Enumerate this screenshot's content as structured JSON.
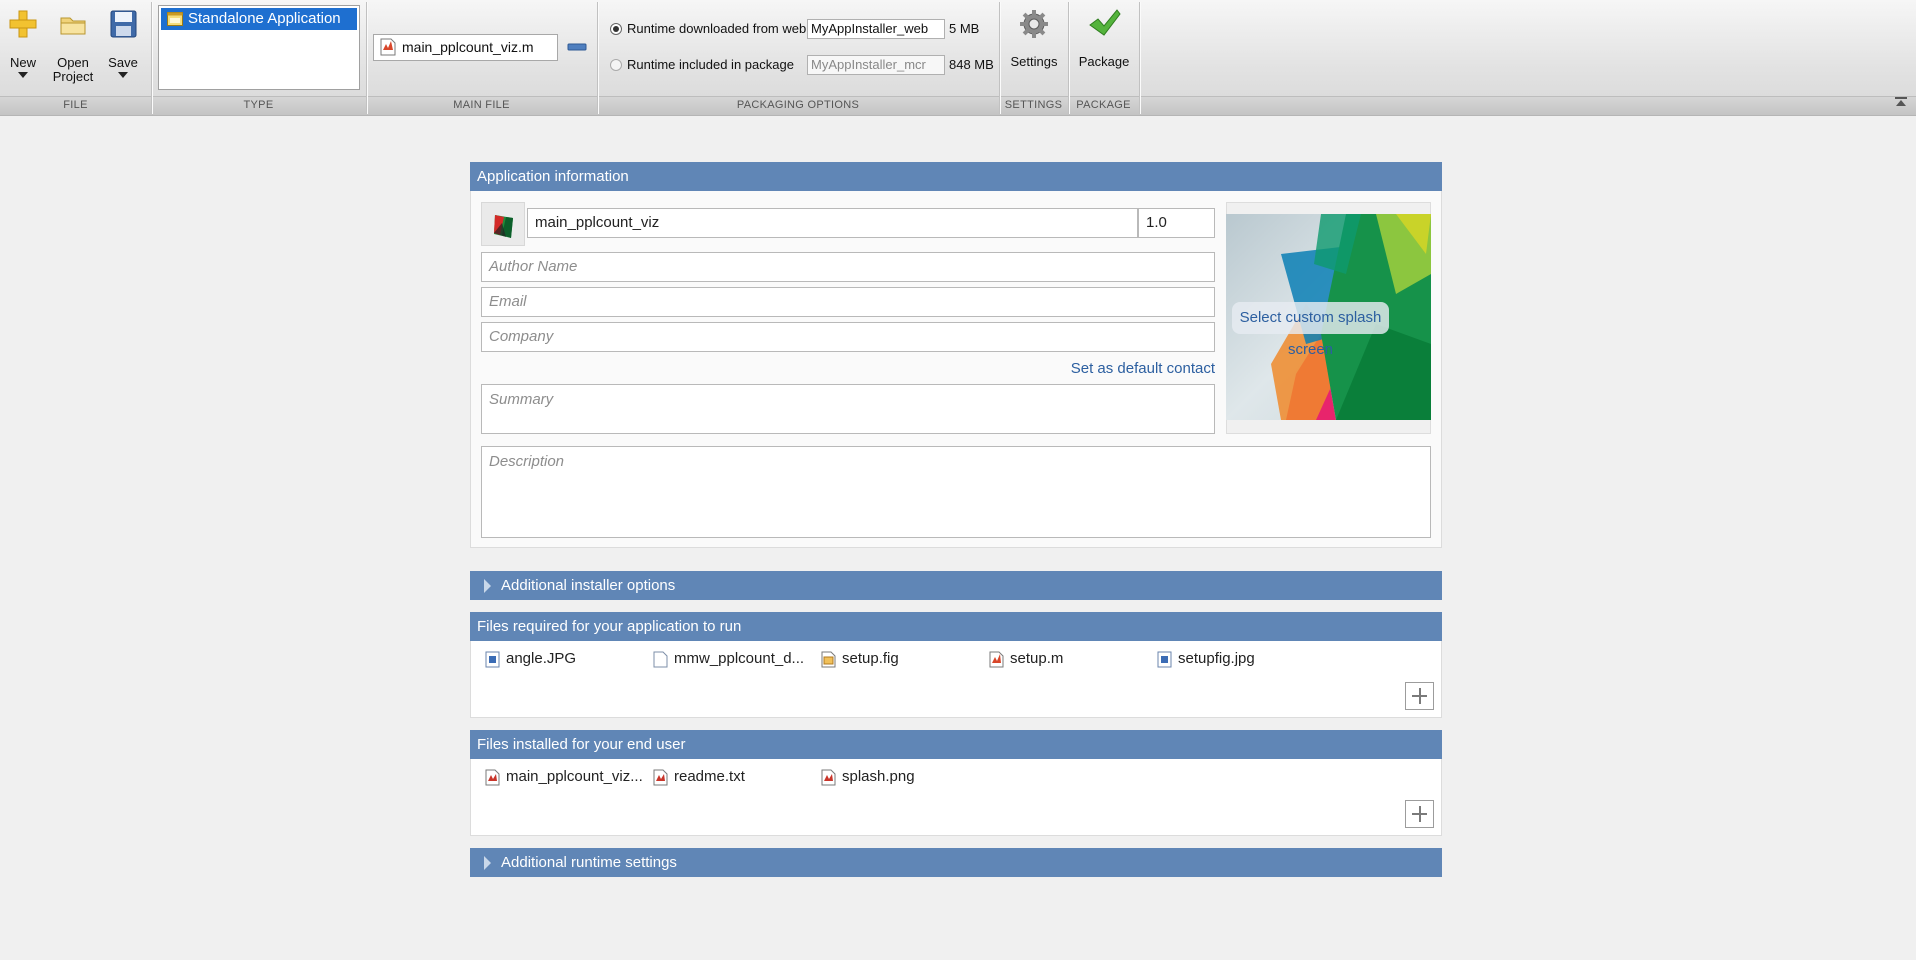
{
  "toolbar": {
    "new_label": "New",
    "open_label_1": "Open",
    "open_label_2": "Project",
    "save_label": "Save",
    "settings_label": "Settings",
    "package_label": "Package"
  },
  "groups": {
    "file": "FILE",
    "type": "TYPE",
    "main_file": "MAIN FILE",
    "packaging_options": "PACKAGING OPTIONS",
    "settings": "SETTINGS",
    "package": "PACKAGE"
  },
  "type_list": {
    "selected": "Standalone Application"
  },
  "main_file": {
    "name": "main_pplcount_viz.m"
  },
  "packaging": {
    "web_label": "Runtime downloaded from web",
    "web_name": "MyAppInstaller_web",
    "web_size": "5 MB",
    "web_selected": true,
    "mcr_label": "Runtime included in package",
    "mcr_name": "MyAppInstaller_mcr",
    "mcr_size": "848 MB",
    "mcr_selected": false
  },
  "app_info": {
    "header": "Application information",
    "app_name": "main_pplcount_viz",
    "version": "1.0",
    "author_placeholder": "Author Name",
    "email_placeholder": "Email",
    "company_placeholder": "Company",
    "default_contact_link": "Set as default contact",
    "summary_placeholder": "Summary",
    "description_placeholder": "Description",
    "splash_button": "Select custom splash screen"
  },
  "sections": {
    "installer_options": "Additional installer options",
    "files_required": "Files required for your application to run",
    "files_installed": "Files installed for your end user",
    "runtime_settings": "Additional runtime settings"
  },
  "files_required": [
    {
      "name": "angle.JPG",
      "icon": "image-file-icon"
    },
    {
      "name": "mmw_pplcount_d...",
      "icon": "blank-file-icon"
    },
    {
      "name": "setup.fig",
      "icon": "fig-file-icon"
    },
    {
      "name": "setup.m",
      "icon": "m-file-icon"
    },
    {
      "name": "setupfig.jpg",
      "icon": "image-file-icon"
    }
  ],
  "files_installed": [
    {
      "name": "main_pplcount_viz...",
      "icon": "app-file-icon"
    },
    {
      "name": "readme.txt",
      "icon": "text-file-icon"
    },
    {
      "name": "splash.png",
      "icon": "image-file-icon"
    }
  ],
  "colors": {
    "section_header": "#6086b6",
    "selection": "#1e6fd0",
    "link": "#2c5fa0"
  }
}
